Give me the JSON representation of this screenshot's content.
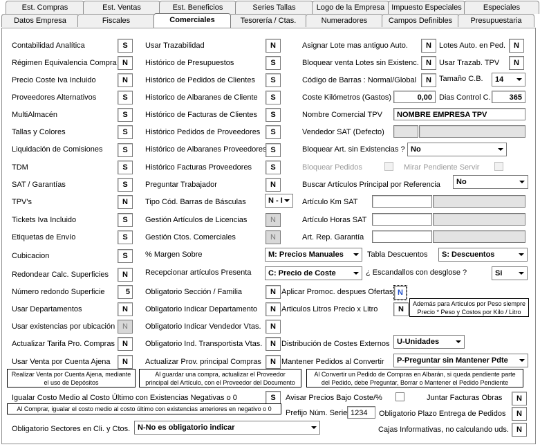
{
  "tabs_row1": [
    {
      "label": "Est. Compras"
    },
    {
      "label": "Est. Ventas"
    },
    {
      "label": "Est. Beneficios"
    },
    {
      "label": "Series Tallas"
    },
    {
      "label": "Logo de la Empresa"
    },
    {
      "label": "Impuesto Especiales"
    },
    {
      "label": "Especiales"
    }
  ],
  "tabs_row2": [
    {
      "label": "Datos Empresa"
    },
    {
      "label": "Fiscales"
    },
    {
      "label": "Comerciales"
    },
    {
      "label": "Tesorería / Ctas."
    },
    {
      "label": "Numeradores"
    },
    {
      "label": "Campos Definibles"
    },
    {
      "label": "Presupuestaria"
    }
  ],
  "col1": [
    {
      "label": "Contabilidad Analítica",
      "value": "S"
    },
    {
      "label": "Régimen Equivalencia Compra",
      "value": "N"
    },
    {
      "label": "Precio Coste Iva Incluido",
      "value": "N"
    },
    {
      "label": "Proveedores Alternativos",
      "value": "S"
    },
    {
      "label": "MultiAlmacén",
      "value": "S"
    },
    {
      "label": "Tallas y Colores",
      "value": "S"
    },
    {
      "label": "Liquidación de Comisiones",
      "value": "S"
    },
    {
      "label": "TDM",
      "value": "S"
    },
    {
      "label": "SAT / Garantías",
      "value": "S"
    },
    {
      "label": "TPV's",
      "value": "N"
    },
    {
      "label": "Tickets Iva Incluido",
      "value": "S"
    },
    {
      "label": "Etiquetas de Envío",
      "value": "S"
    },
    {
      "label": "Cubicacion",
      "value": "S"
    },
    {
      "label": "Redondear Calc. Superficies",
      "value": "N"
    },
    {
      "label": "Número redondo Superficie",
      "value": "5"
    },
    {
      "label": "Usar Departamentos",
      "value": "N"
    },
    {
      "label": "Usar existencias por ubicación",
      "value": "N"
    },
    {
      "label": "Actualizar Tarifa Pro. Compras",
      "value": "N"
    },
    {
      "label": "Usar Venta por Cuenta Ajena",
      "value": "N"
    }
  ],
  "col2": [
    {
      "label": "Usar Trazabilidad",
      "value": "N"
    },
    {
      "label": "Histórico de Presupuestos",
      "value": "S"
    },
    {
      "label": "Histórico de Pedidos de Clientes",
      "value": "S"
    },
    {
      "label": "Historico de Albaranes de Cliente",
      "value": "S"
    },
    {
      "label": "Histórico de Facturas de Clientes",
      "value": "S"
    },
    {
      "label": "Histórico Pedidos de Proveedores",
      "value": "S"
    },
    {
      "label": "Histórico de Albaranes Proveedores",
      "value": "S"
    },
    {
      "label": "Histórico Facturas Proveedores",
      "value": "S"
    },
    {
      "label": "Preguntar Trabajador",
      "value": "N"
    },
    {
      "label": "Tipo Cód. Barras de Básculas",
      "value": "N - I"
    },
    {
      "label": "Gestión Artículos de Licencias",
      "value": "N"
    },
    {
      "label": "Gestión Ctos. Comerciales",
      "value": "N"
    },
    {
      "label": "% Margen Sobre",
      "value": "M: Precios  Manuales"
    },
    {
      "label": "Recepcionar artículos Presenta",
      "value": "C: Precio de Coste"
    },
    {
      "label": "Obligatorio Sección / Familia",
      "value": "N"
    },
    {
      "label": "Obligatorio Indicar Departamento",
      "value": "N"
    },
    {
      "label": "Obligatorio Indicar Vendedor Vtas.",
      "value": "N"
    },
    {
      "label": "Obligatorio Ind. Transportista Vtas.",
      "value": "N"
    },
    {
      "label": "Actualizar Prov. principal Compras",
      "value": "N"
    }
  ],
  "col3": {
    "asignar_lote": {
      "label": "Asignar Lote mas antiguo Auto.",
      "value": "N"
    },
    "lotes_auto": {
      "label": "Lotes Auto. en Ped.",
      "value": "N"
    },
    "bloquear_lotes": {
      "label": "Bloquear venta Lotes sin Existenc.",
      "value": "N"
    },
    "usar_trazab": {
      "label": "Usar Trazab. TPV",
      "value": "N"
    },
    "codigo_barras": {
      "label": "Código de Barras : Normal/Global",
      "value": "N"
    },
    "tamano_cb": {
      "label": "Tamaño C.B.",
      "value": "14"
    },
    "coste_km": {
      "label": "Coste Kilómetros (Gastos)",
      "value": "0,00"
    },
    "dias_control": {
      "label": "Dias Control C.",
      "value": "365"
    },
    "nombre_tpv": {
      "label": "Nombre Comercial TPV",
      "value": "NOMBRE EMPRESA TPV"
    },
    "vendedor_sat": {
      "label": "Vendedor SAT (Defecto)"
    },
    "bloquear_art": {
      "label": "Bloquear Art. sin Existencias ?",
      "value": "No"
    },
    "bloquear_pedidos": {
      "label": "Bloquear Pedidos"
    },
    "mirar_pendiente": {
      "label": "Mirar Pendiente Servir"
    },
    "buscar_articulos": {
      "label": "Buscar Artículos Principal por Referencia",
      "value": "No"
    },
    "articulo_km": {
      "label": "Artículo Km SAT"
    },
    "articulo_horas": {
      "label": "Artículo Horas SAT"
    },
    "art_rep": {
      "label": "Art. Rep. Garantía"
    },
    "tabla_descuentos": {
      "label": "Tabla Descuentos",
      "value": "S: Descuentos"
    },
    "escandallos": {
      "label": "¿ Escandallos con desglose ?",
      "value": "Si"
    },
    "aplicar_promoc": {
      "label": "Aplicar Promoc. despues Ofertas",
      "value": "N"
    },
    "articulos_litros": {
      "label": "Articulos Litros Precio x Litro",
      "value": "N"
    },
    "distribucion": {
      "label": "Distribución de Costes Externos",
      "value": "U-Unidades"
    },
    "mantener_pedidos": {
      "label": "Mantener Pedidos al Convertir",
      "value": "P-Preguntar sin Mantener Pdte"
    }
  },
  "notes": {
    "peso": [
      "Además para Articulos por Peso siempre",
      "Precio * Peso y Costos por Kilo / Litro"
    ],
    "venta_ajena": [
      "Realizar Venta por Cuenta Ajena, mediante",
      "el uso de Depósitos"
    ],
    "guardar_compra": [
      "Al guardar una compra, actualizar el Proveedor",
      "principal del Artículo, con el Proveedor del Documento"
    ],
    "convertir_pedido": [
      "Al Convertir un Pedido de Compras en Albarán, si queda pendiente parte",
      "del Pedido, debe Preguntar, Borrar o Mantener el Pedido Pendiente"
    ],
    "costo_medio": "Al Comprar, igualar el costo medio al costo último con existencias anteriores en negativo o 0"
  },
  "bottom": {
    "igualar_costo": {
      "label": "Igualar Costo Medio al Costo Último con Existencias Negativas o 0",
      "value": "S"
    },
    "avisar_precios": {
      "label": "Avisar Precios Bajo Coste/%"
    },
    "juntar_facturas": {
      "label": "Juntar Facturas Obras",
      "value": "N"
    },
    "prefijo": {
      "label": "Prefijo Núm. Serie",
      "value": "1234"
    },
    "obligatorio_plazo": {
      "label": "Obligatorio Plazo Entrega de Pedidos",
      "value": "N"
    },
    "obligatorio_sectores": {
      "label": "Obligatorio Sectores en Cli. y Ctos.",
      "value": "N-No es obligatorio indicar"
    },
    "cajas_informativas": {
      "label": "Cajas Informativas, no calculando uds.",
      "value": "N"
    }
  }
}
